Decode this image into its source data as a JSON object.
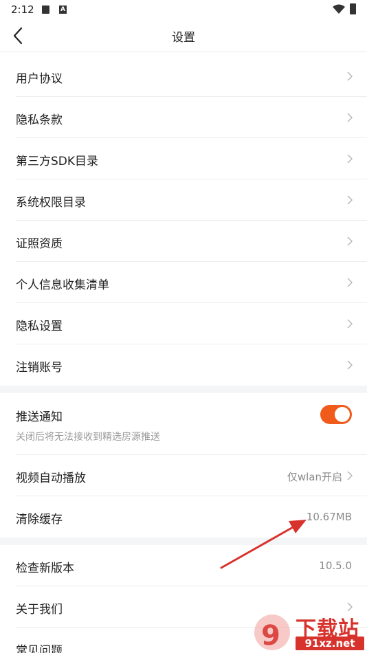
{
  "status_bar": {
    "time": "2:12"
  },
  "header": {
    "title": "设置"
  },
  "section1": [
    {
      "label": "用户协议"
    },
    {
      "label": "隐私条款"
    },
    {
      "label": "第三方SDK目录"
    },
    {
      "label": "系统权限目录"
    },
    {
      "label": "证照资质"
    },
    {
      "label": "个人信息收集清单"
    },
    {
      "label": "隐私设置"
    },
    {
      "label": "注销账号"
    }
  ],
  "push": {
    "label": "推送通知",
    "subtitle": "关闭后将无法接收到精选房源推送",
    "enabled": true
  },
  "video": {
    "label": "视频自动播放",
    "value": "仅wlan开启"
  },
  "cache": {
    "label": "清除缓存",
    "value": "10.67MB"
  },
  "version": {
    "label": "检查新版本",
    "value": "10.5.0"
  },
  "about": {
    "label": "关于我们"
  },
  "faq": {
    "label": "常见问题"
  },
  "watermark": {
    "brand": "下载站",
    "domain": "91xz.net"
  },
  "colors": {
    "accent": "#f05a1a",
    "annotation_arrow": "#d8322c"
  }
}
